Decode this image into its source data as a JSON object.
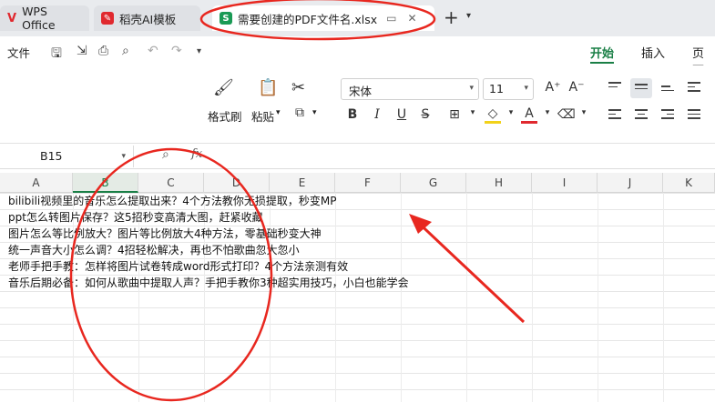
{
  "tabs": [
    {
      "label": "WPS Office",
      "icon": "wps-logo-icon",
      "color": "#e0292f"
    },
    {
      "label": "稻壳AI模板",
      "icon": "docer-logo-icon",
      "color": "#e0292f"
    },
    {
      "label": "需要创建的PDF文件名.xlsx",
      "icon": "spreadsheet-icon",
      "icon_text": "S",
      "color": "#1a9a55"
    }
  ],
  "menu": {
    "file": "文件",
    "tabs": [
      "开始",
      "插入",
      "页面"
    ],
    "active_tab": "开始"
  },
  "ribbon": {
    "format_painter": "格式刷",
    "paste": "粘贴",
    "font": "宋体",
    "size": "11",
    "bold": "B",
    "italic": "I",
    "underline": "U",
    "accent_color": "#1a7f46"
  },
  "formula": {
    "cell_ref": "B15",
    "fx": "fx"
  },
  "columns": [
    "A",
    "B",
    "C",
    "D",
    "E",
    "F",
    "G",
    "H",
    "I",
    "J",
    "K"
  ],
  "selected_column": "B",
  "rows": [
    "bilibili视频里的音乐怎么提取出来？4个方法教你无损提取，秒变MP",
    "ppt怎么转图片保存？这5招秒变高清大图，赶紧收藏",
    "图片怎么等比例放大？图片等比例放大4种方法，零基础秒变大神",
    "统一声音大小怎么调？4招轻松解决，再也不怕歌曲忽大忽小",
    "老师手把手教：怎样将图片试卷转成word形式打印？4个方法亲测有效",
    "音乐后期必备：如何从歌曲中提取人声？手把手教你3种超实用技巧，小白也能学会"
  ],
  "annotation_color": "#e8271f"
}
